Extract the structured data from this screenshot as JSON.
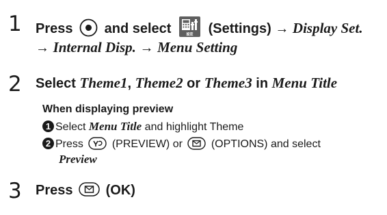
{
  "step1": {
    "number": "1",
    "press": "Press",
    "and_select": "and select",
    "settings": "(Settings)",
    "display_set": "Display Set",
    "period": ".",
    "arrow": "→",
    "internal_disp": "Internal Disp.",
    "menu_setting": "Menu Setting",
    "settings_icon_text": "設定"
  },
  "step2": {
    "number": "2",
    "select": "Select",
    "theme1": "Theme1",
    "comma": ",",
    "theme2": "Theme2",
    "or": "or",
    "theme3": "Theme3",
    "in": "in",
    "menu_title": "Menu Title",
    "preview_heading": "When displaying preview",
    "sub1": {
      "num": "1",
      "select": "Select",
      "menu_title": "Menu Title",
      "rest": "and highlight Theme"
    },
    "sub2": {
      "num": "2",
      "press": "Press",
      "preview_label": "(PREVIEW) or",
      "options_label": "(OPTIONS) and select",
      "preview_item": "Preview"
    }
  },
  "step3": {
    "number": "3",
    "press": "Press",
    "ok": "(OK)"
  },
  "colors": {
    "text": "#1a1a1a",
    "icon_bg": "#5f5f5f"
  },
  "icons": [
    "center-key-icon",
    "settings-icon",
    "y-key-icon",
    "mail-key-icon"
  ]
}
